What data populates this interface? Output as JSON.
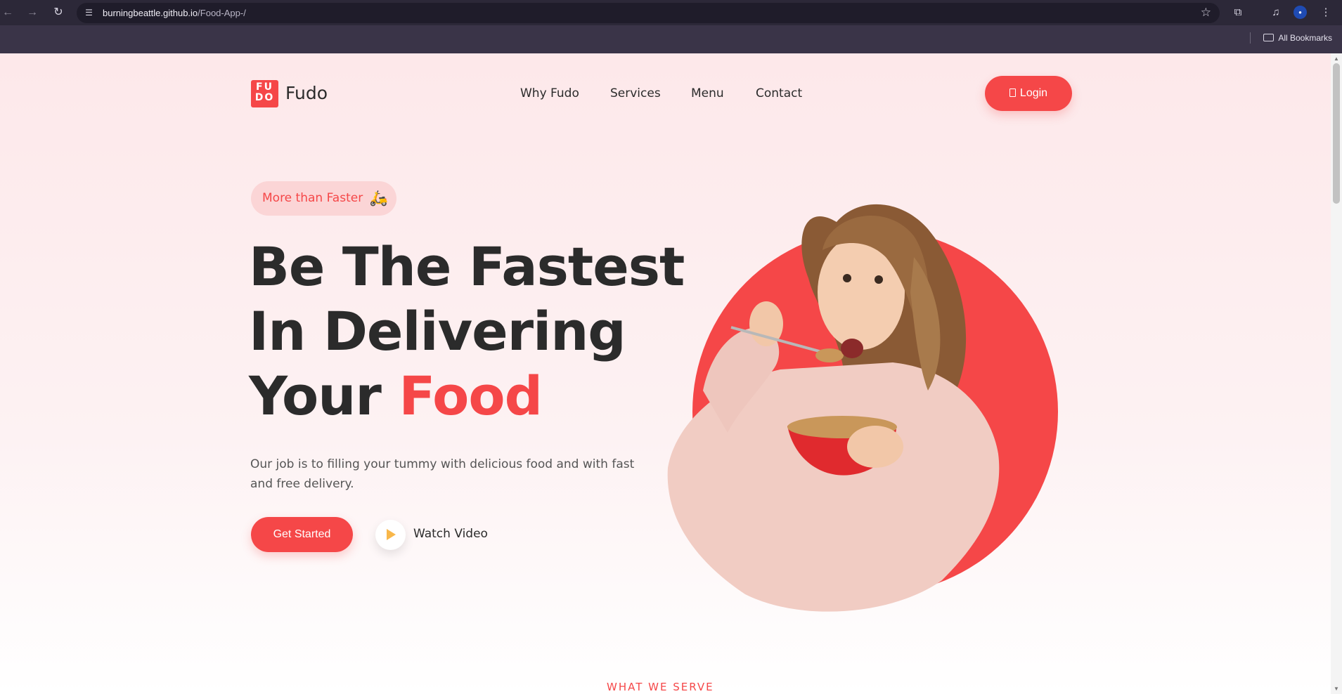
{
  "browser": {
    "url_host": "burningbeattle.github.io",
    "url_path": "/Food-App-/",
    "bookmarks_label": "All Bookmarks",
    "back_icon": "arrow-left-icon",
    "forward_icon": "arrow-right-icon",
    "reload_icon": "reload-icon"
  },
  "header": {
    "logo_text": "Fudo",
    "logo_letters_top": "FU",
    "logo_letters_bottom": "DO",
    "nav": [
      {
        "label": "Why Fudo"
      },
      {
        "label": "Services"
      },
      {
        "label": "Menu"
      },
      {
        "label": "Contact"
      }
    ],
    "login_label": "Login"
  },
  "hero": {
    "badge_label": "More than Faster",
    "title_line1": "Be The Fastest",
    "title_line2": "In Delivering",
    "title_line3_plain": "Your ",
    "title_line3_accent": "Food",
    "description": "Our job is to filling your tummy with delicious food and with fast and free delivery.",
    "cta_label": "Get Started",
    "video_label": "Watch Video"
  },
  "section": {
    "label": "WHAT WE SERVE"
  },
  "colors": {
    "accent": "#f54748",
    "play_icon": "#f8b74a",
    "text": "#2b2b2b"
  }
}
